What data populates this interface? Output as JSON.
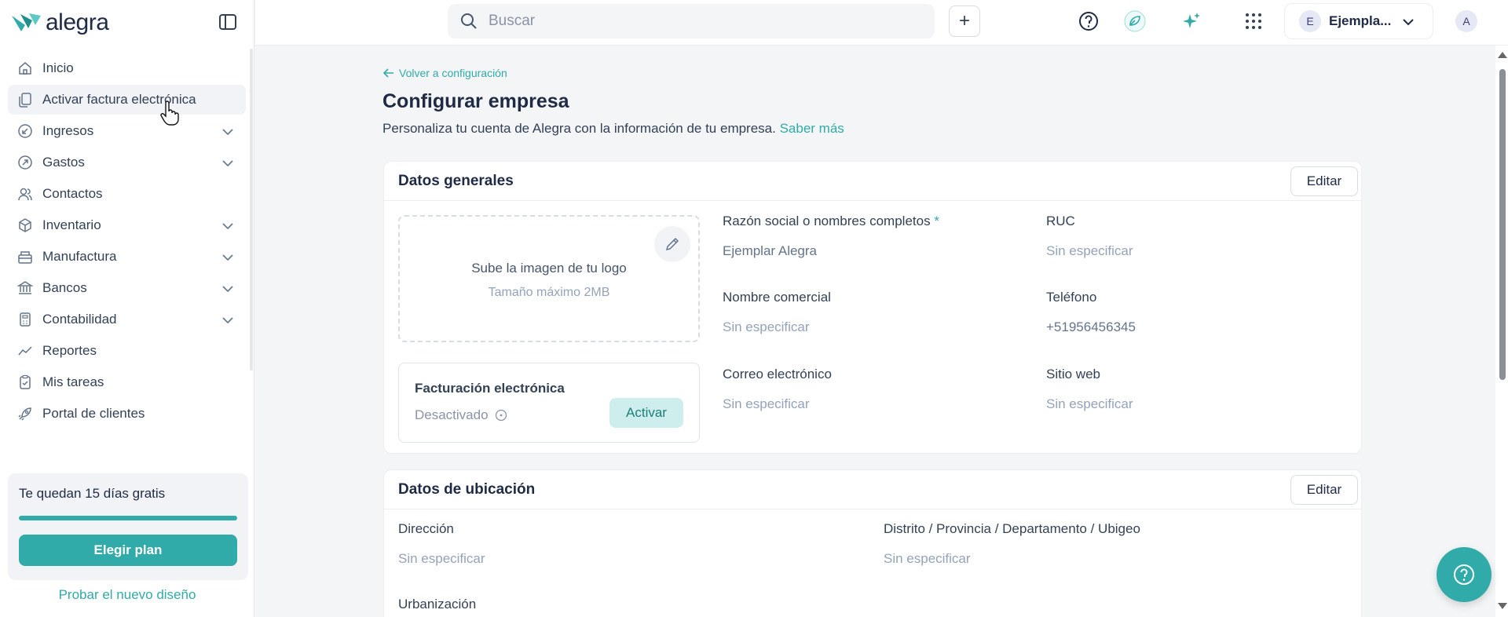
{
  "brand": {
    "name": "alegra",
    "accent": "#30aba9"
  },
  "sidebar": {
    "items": [
      {
        "label": "Inicio",
        "icon": "home-icon",
        "chevron": false
      },
      {
        "label": "Activar factura electrónica",
        "icon": "documents-icon",
        "chevron": false,
        "active": true
      },
      {
        "label": "Ingresos",
        "icon": "income-icon",
        "chevron": true
      },
      {
        "label": "Gastos",
        "icon": "expense-icon",
        "chevron": true
      },
      {
        "label": "Contactos",
        "icon": "contacts-icon",
        "chevron": false
      },
      {
        "label": "Inventario",
        "icon": "box-icon",
        "chevron": true
      },
      {
        "label": "Manufactura",
        "icon": "factory-icon",
        "chevron": true
      },
      {
        "label": "Bancos",
        "icon": "bank-icon",
        "chevron": true
      },
      {
        "label": "Contabilidad",
        "icon": "calculator-icon",
        "chevron": true
      },
      {
        "label": "Reportes",
        "icon": "chart-line-icon",
        "chevron": false
      },
      {
        "label": "Mis tareas",
        "icon": "clipboard-icon",
        "chevron": false
      },
      {
        "label": "Portal de clientes",
        "icon": "rocket-icon",
        "chevron": false
      }
    ],
    "trial": {
      "text": "Te quedan 15 días gratis",
      "progress": 1.0,
      "button": "Elegir plan"
    },
    "new_design": "Probar el nuevo diseño"
  },
  "topbar": {
    "search_placeholder": "Buscar",
    "company": {
      "initial": "E",
      "name": "Ejempla..."
    },
    "user_initial": "A"
  },
  "main": {
    "back_link": "Volver a configuración",
    "title": "Configurar empresa",
    "subtitle": "Personaliza tu cuenta de Alegra con la información de tu empresa.",
    "subtitle_link": "Saber más",
    "general": {
      "title": "Datos generales",
      "edit": "Editar",
      "upload_title": "Sube la imagen de tu logo",
      "upload_sub": "Tamaño máximo 2MB",
      "einvoice": {
        "title": "Facturación electrónica",
        "status": "Desactivado",
        "button": "Activar"
      },
      "fields": {
        "razon_label": "Razón social o nombres completos",
        "razon_req": "*",
        "razon_value": "Ejemplar Alegra",
        "ruc_label": "RUC",
        "ruc_value": "Sin especificar",
        "nombre_label": "Nombre comercial",
        "nombre_value": "Sin especificar",
        "telefono_label": "Teléfono",
        "telefono_value": "+51956456345",
        "correo_label": "Correo electrónico",
        "correo_value": "Sin especificar",
        "web_label": "Sitio web",
        "web_value": "Sin especificar"
      }
    },
    "location": {
      "title": "Datos de ubicación",
      "edit": "Editar",
      "direccion_label": "Dirección",
      "direccion_value": "Sin especificar",
      "distrito_label": "Distrito / Provincia / Departamento / Ubigeo",
      "distrito_value": "Sin especificar",
      "urbanizacion_label": "Urbanización"
    }
  }
}
